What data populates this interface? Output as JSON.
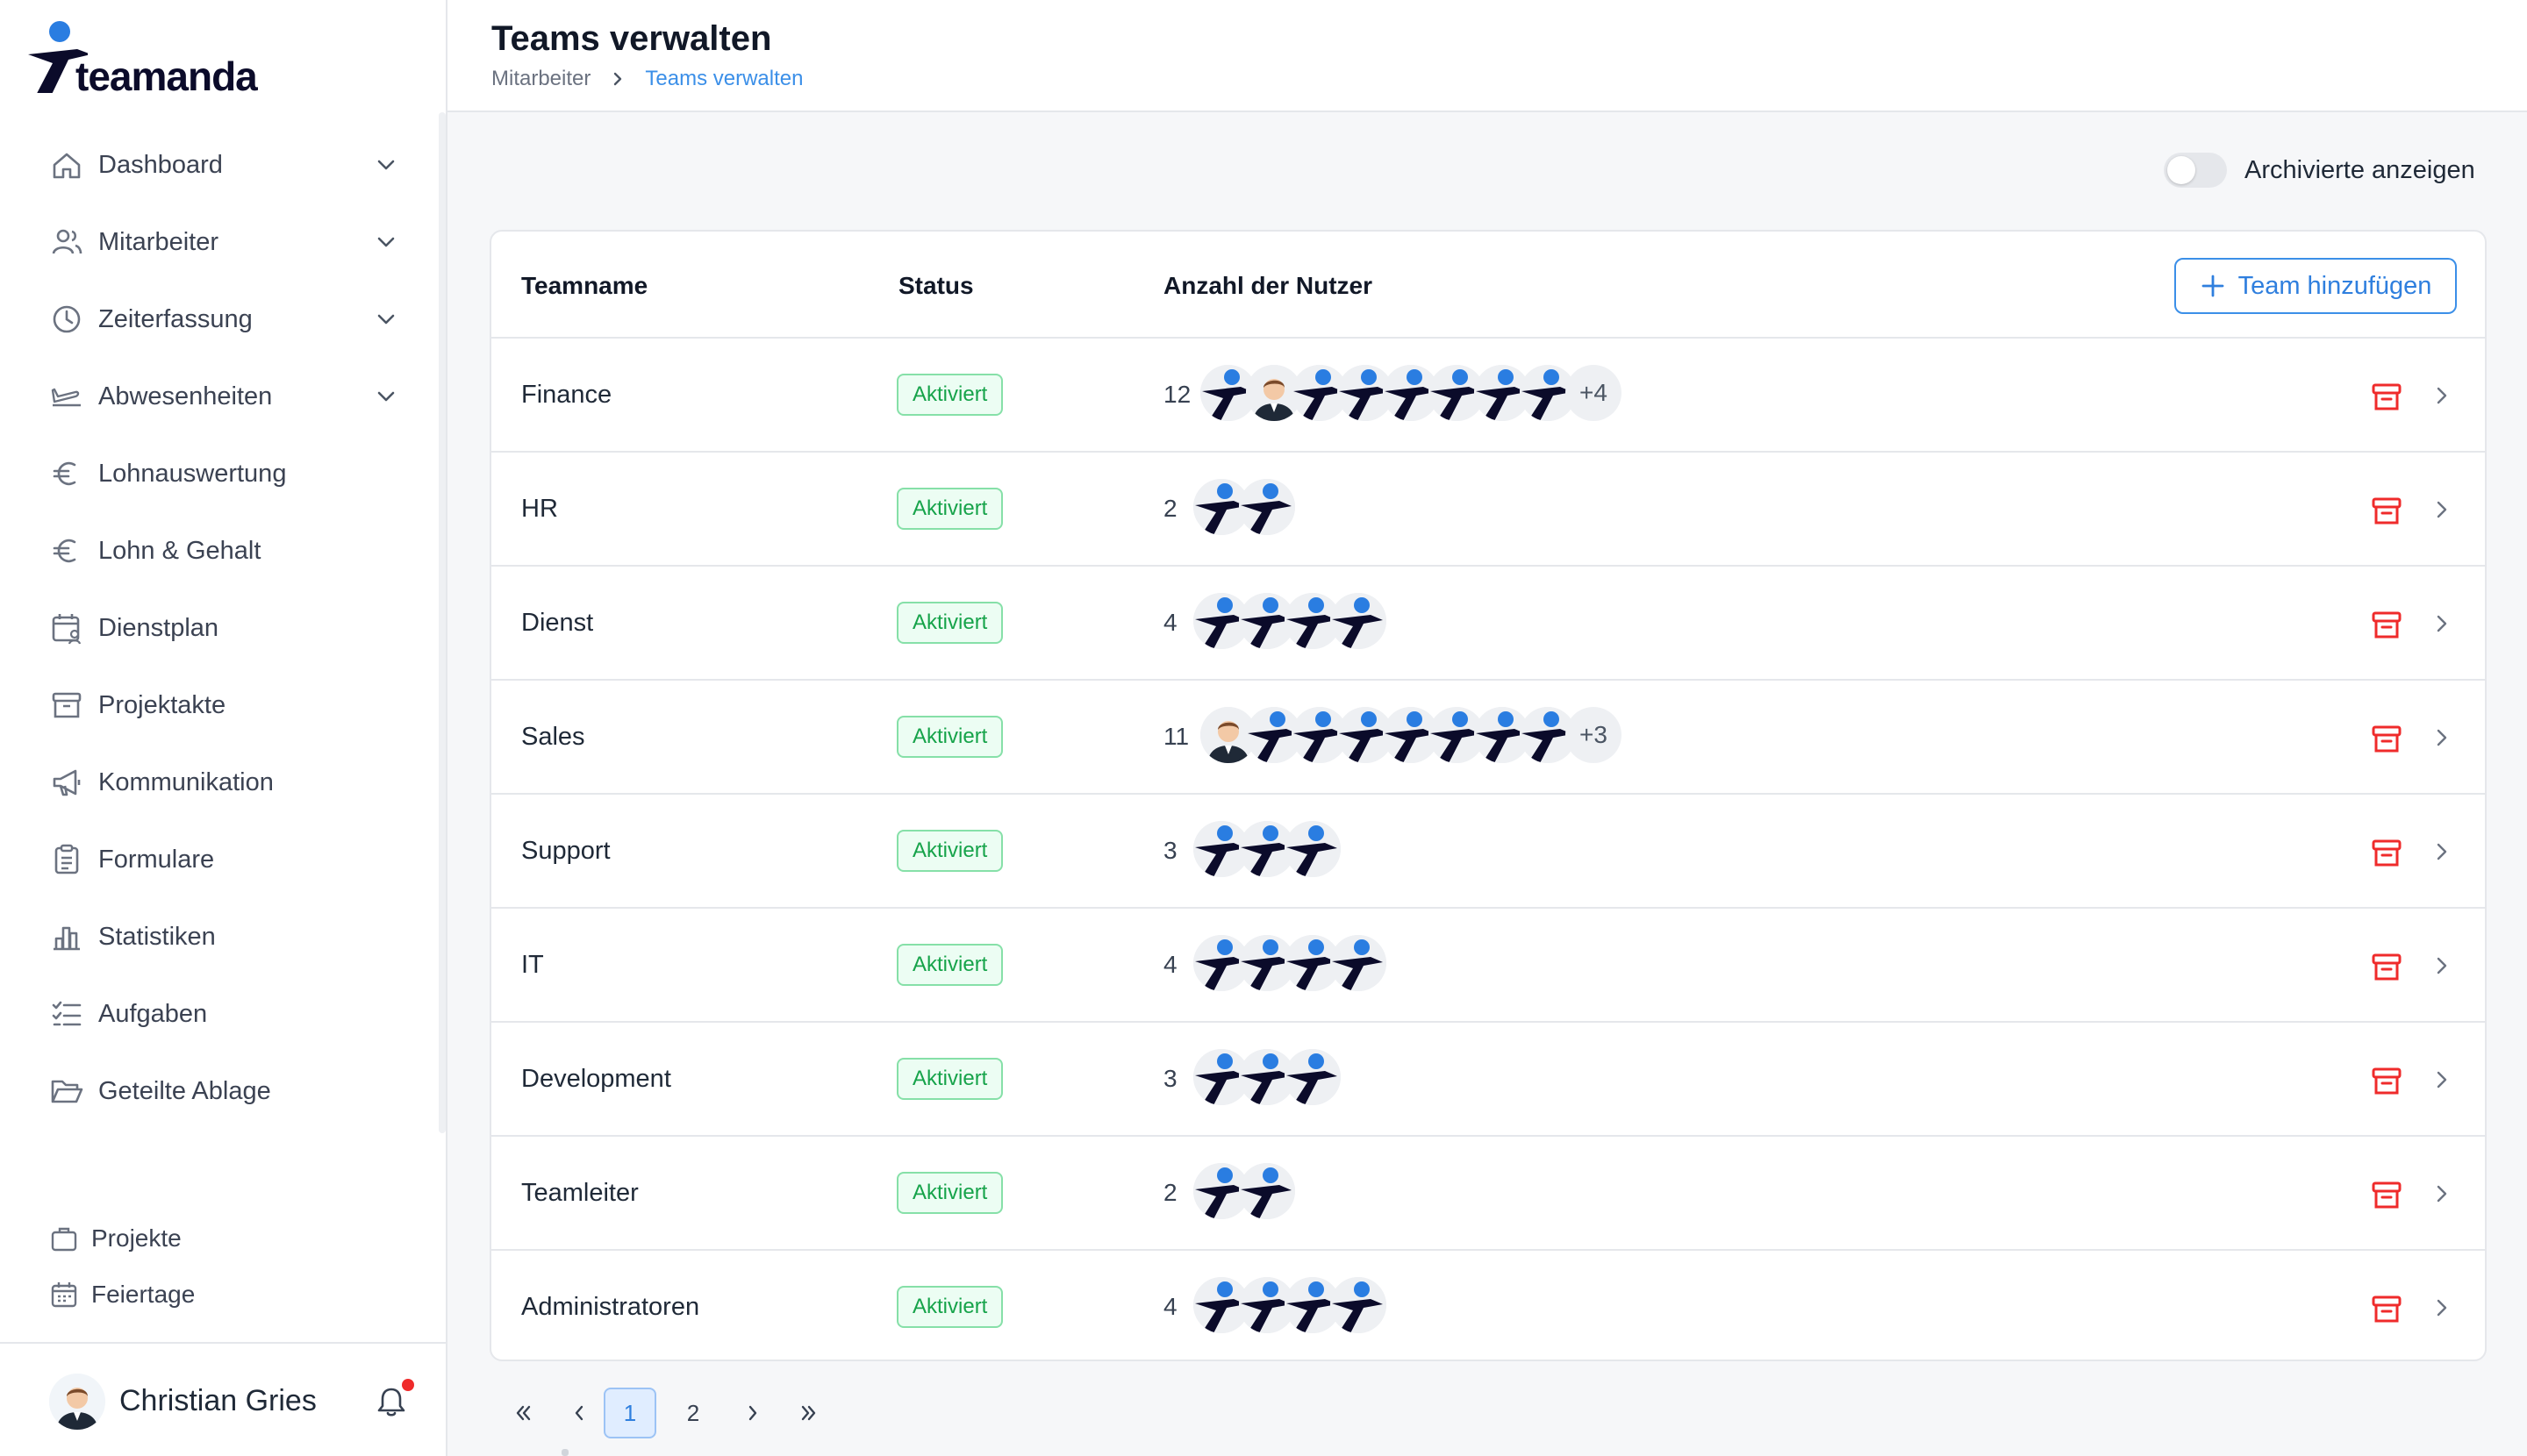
{
  "app": {
    "brand": "teamanda"
  },
  "header": {
    "title": "Teams verwalten",
    "breadcrumb": [
      "Mitarbeiter",
      "Teams verwalten"
    ]
  },
  "sidebar": {
    "items": [
      {
        "label": "Dashboard",
        "icon": "home-icon",
        "expandable": true
      },
      {
        "label": "Mitarbeiter",
        "icon": "users-icon",
        "expandable": true
      },
      {
        "label": "Zeiterfassung",
        "icon": "clock-icon",
        "expandable": true
      },
      {
        "label": "Abwesenheiten",
        "icon": "airplane-icon",
        "expandable": true
      },
      {
        "label": "Lohnauswertung",
        "icon": "euro-icon",
        "expandable": false
      },
      {
        "label": "Lohn & Gehalt",
        "icon": "euro-icon",
        "expandable": false
      },
      {
        "label": "Dienstplan",
        "icon": "calendar-user-icon",
        "expandable": false
      },
      {
        "label": "Projektakte",
        "icon": "archive-box-icon",
        "expandable": false
      },
      {
        "label": "Kommunikation",
        "icon": "megaphone-icon",
        "expandable": false
      },
      {
        "label": "Formulare",
        "icon": "clipboard-icon",
        "expandable": false
      },
      {
        "label": "Statistiken",
        "icon": "bar-chart-icon",
        "expandable": false
      },
      {
        "label": "Aufgaben",
        "icon": "checklist-icon",
        "expandable": false
      },
      {
        "label": "Geteilte Ablage",
        "icon": "folder-open-icon",
        "expandable": false
      }
    ],
    "sub_items": [
      {
        "label": "Projekte",
        "icon": "briefcase-icon"
      },
      {
        "label": "Feiertage",
        "icon": "calendar-icon"
      }
    ],
    "user": {
      "name": "Christian Gries",
      "has_notification": true
    }
  },
  "toolbar": {
    "archived_toggle_label": "Archivierte anzeigen",
    "archived_toggle_on": false
  },
  "table": {
    "columns": [
      "Teamname",
      "Status",
      "Anzahl der Nutzer"
    ],
    "add_button_label": "Team hinzufügen",
    "rows": [
      {
        "name": "Finance",
        "status": "Aktiviert",
        "count": "12",
        "avatars": [
          "logo",
          "photo",
          "logo",
          "logo",
          "logo",
          "logo",
          "logo",
          "logo"
        ],
        "more": "+4"
      },
      {
        "name": "HR",
        "status": "Aktiviert",
        "count": "2",
        "avatars": [
          "logo",
          "logo"
        ],
        "more": ""
      },
      {
        "name": "Dienst",
        "status": "Aktiviert",
        "count": "4",
        "avatars": [
          "logo",
          "logo",
          "logo",
          "logo"
        ],
        "more": ""
      },
      {
        "name": "Sales",
        "status": "Aktiviert",
        "count": "11",
        "avatars": [
          "photo",
          "logo",
          "logo",
          "logo",
          "logo",
          "logo",
          "logo",
          "logo"
        ],
        "more": "+3"
      },
      {
        "name": "Support",
        "status": "Aktiviert",
        "count": "3",
        "avatars": [
          "logo",
          "logo",
          "logo"
        ],
        "more": ""
      },
      {
        "name": "IT",
        "status": "Aktiviert",
        "count": "4",
        "avatars": [
          "logo",
          "logo",
          "logo",
          "logo"
        ],
        "more": ""
      },
      {
        "name": "Development",
        "status": "Aktiviert",
        "count": "3",
        "avatars": [
          "logo",
          "logo",
          "logo"
        ],
        "more": ""
      },
      {
        "name": "Teamleiter",
        "status": "Aktiviert",
        "count": "2",
        "avatars": [
          "logo",
          "logo"
        ],
        "more": ""
      },
      {
        "name": "Administratoren",
        "status": "Aktiviert",
        "count": "4",
        "avatars": [
          "logo",
          "logo",
          "logo",
          "logo"
        ],
        "more": ""
      }
    ]
  },
  "pagination": {
    "pages": [
      "1",
      "2"
    ],
    "current": "1"
  },
  "colors": {
    "accent": "#3b8fe8",
    "success": "#16a34a",
    "danger": "#ef2b2b",
    "brand_dark": "#0b0b2a"
  }
}
